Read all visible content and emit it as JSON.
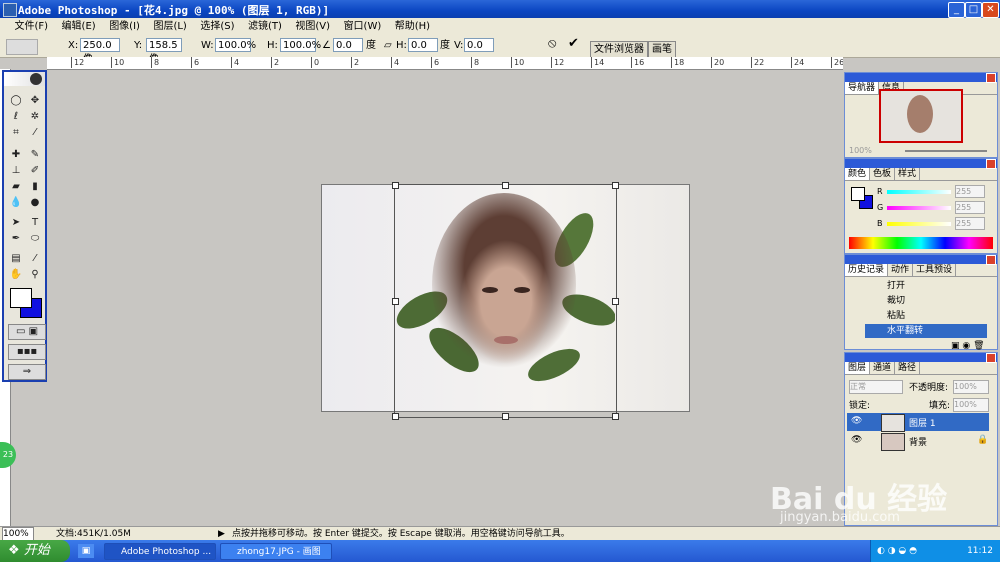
{
  "window": {
    "title": "Adobe Photoshop - [花4.jpg @ 100% (图层 1, RGB)]",
    "minimize": "_",
    "restore": "□",
    "close": "✕"
  },
  "menu": [
    {
      "label": "文件(F)"
    },
    {
      "label": "编辑(E)"
    },
    {
      "label": "图像(I)"
    },
    {
      "label": "图层(L)"
    },
    {
      "label": "选择(S)"
    },
    {
      "label": "滤镜(T)"
    },
    {
      "label": "视图(V)"
    },
    {
      "label": "窗口(W)"
    },
    {
      "label": "帮助(H)"
    }
  ],
  "options": {
    "x_label": "X:",
    "x": "250.0 像",
    "y_label": "Y:",
    "y": "158.5 像",
    "w_label": "W:",
    "w": "100.0%",
    "h_label": "H:",
    "h": "100.0%",
    "angle": "0.0",
    "angle_unit": "度",
    "hskew_label": "H:",
    "hskew": "0.0",
    "hskew_unit": "度",
    "vskew_label": "V:",
    "vskew": "0.0",
    "cancel": "⦸",
    "commit": "✔",
    "tab_browser": "文件浏览器",
    "tab_brush": "画笔"
  },
  "ruler_ticks": [
    "12",
    "10",
    "8",
    "6",
    "4",
    "2",
    "0",
    "2",
    "4",
    "6",
    "8",
    "10",
    "12",
    "14",
    "16",
    "18",
    "20",
    "22",
    "24",
    "26"
  ],
  "navigator": {
    "tabs": [
      "导航器",
      "信息"
    ],
    "zoom": "100%"
  },
  "color_panel": {
    "tabs": [
      "颜色",
      "色板",
      "样式"
    ],
    "r_label": "R",
    "g_label": "G",
    "b_label": "B",
    "r": "255",
    "g": "255",
    "b": "255",
    "foreground": "#ffffff",
    "background": "#1010e0"
  },
  "history": {
    "tabs": [
      "历史记录",
      "动作",
      "工具预设"
    ],
    "items": [
      {
        "label": "打开"
      },
      {
        "label": "裁切"
      },
      {
        "label": "粘贴"
      },
      {
        "label": "水平翻转"
      }
    ]
  },
  "layers": {
    "tabs": [
      "图层",
      "通道",
      "路径"
    ],
    "blend": "正常",
    "opacity_label": "不透明度:",
    "opacity": "100%",
    "lock_label": "锁定:",
    "fill_label": "填充:",
    "fill": "100%",
    "items": [
      {
        "name": "图层 1"
      },
      {
        "name": "背景"
      }
    ]
  },
  "status": {
    "zoom": "100%",
    "doc": "文档:451K/1.05M",
    "hint": "点按并拖移可移动。按 Enter 键提交。按 Escape 键取消。用空格键访问导航工具。"
  },
  "taskbar": {
    "start": "开始",
    "tasks": [
      {
        "label": "Adobe Photoshop ..."
      },
      {
        "label": "zhong17.JPG - 画图"
      }
    ],
    "time": "11:12"
  },
  "watermark": {
    "brand": "Bai du 经验",
    "url": "jingyan.baidu.com"
  },
  "side_badge": "23",
  "colors": {
    "title_blue": "#0b46c2",
    "panel_head": "#2c5ad7",
    "selected": "#316ac5"
  }
}
